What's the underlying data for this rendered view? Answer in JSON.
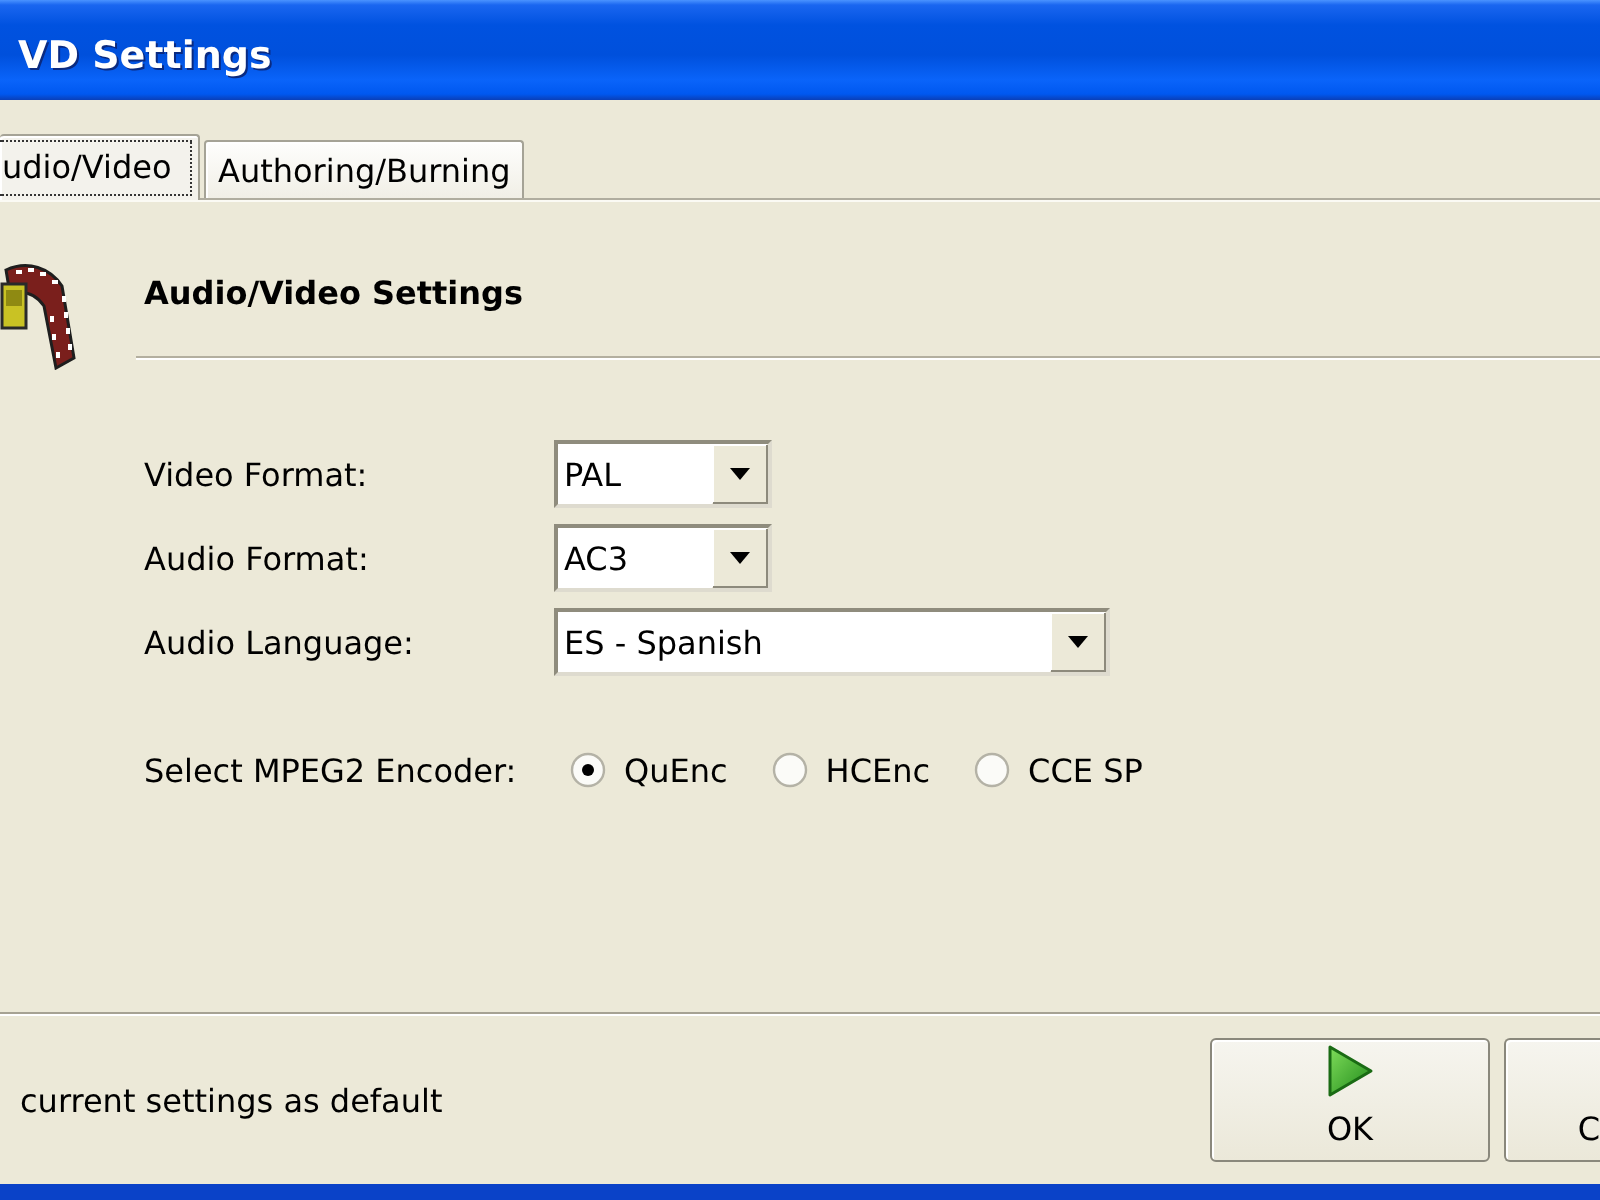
{
  "window": {
    "title": "VD Settings"
  },
  "tabs": [
    {
      "label": "udio/Video",
      "selected": true
    },
    {
      "label": "Authoring/Burning",
      "selected": false
    }
  ],
  "panel": {
    "heading": "Audio/Video Settings",
    "fields": [
      {
        "label": "Video Format:",
        "value": "PAL"
      },
      {
        "label": "Audio Format:",
        "value": "AC3"
      },
      {
        "label": "Audio Language:",
        "value": "ES - Spanish"
      }
    ],
    "encoder": {
      "label": "Select MPEG2 Encoder:",
      "options": [
        {
          "label": "QuEnc",
          "selected": true
        },
        {
          "label": "HCEnc",
          "selected": false
        },
        {
          "label": "CCE SP",
          "selected": false
        }
      ]
    }
  },
  "footer": {
    "note": "current settings as default",
    "buttons": [
      {
        "label": "OK",
        "kind": "play"
      },
      {
        "label": "C",
        "kind": "plain"
      }
    ]
  }
}
